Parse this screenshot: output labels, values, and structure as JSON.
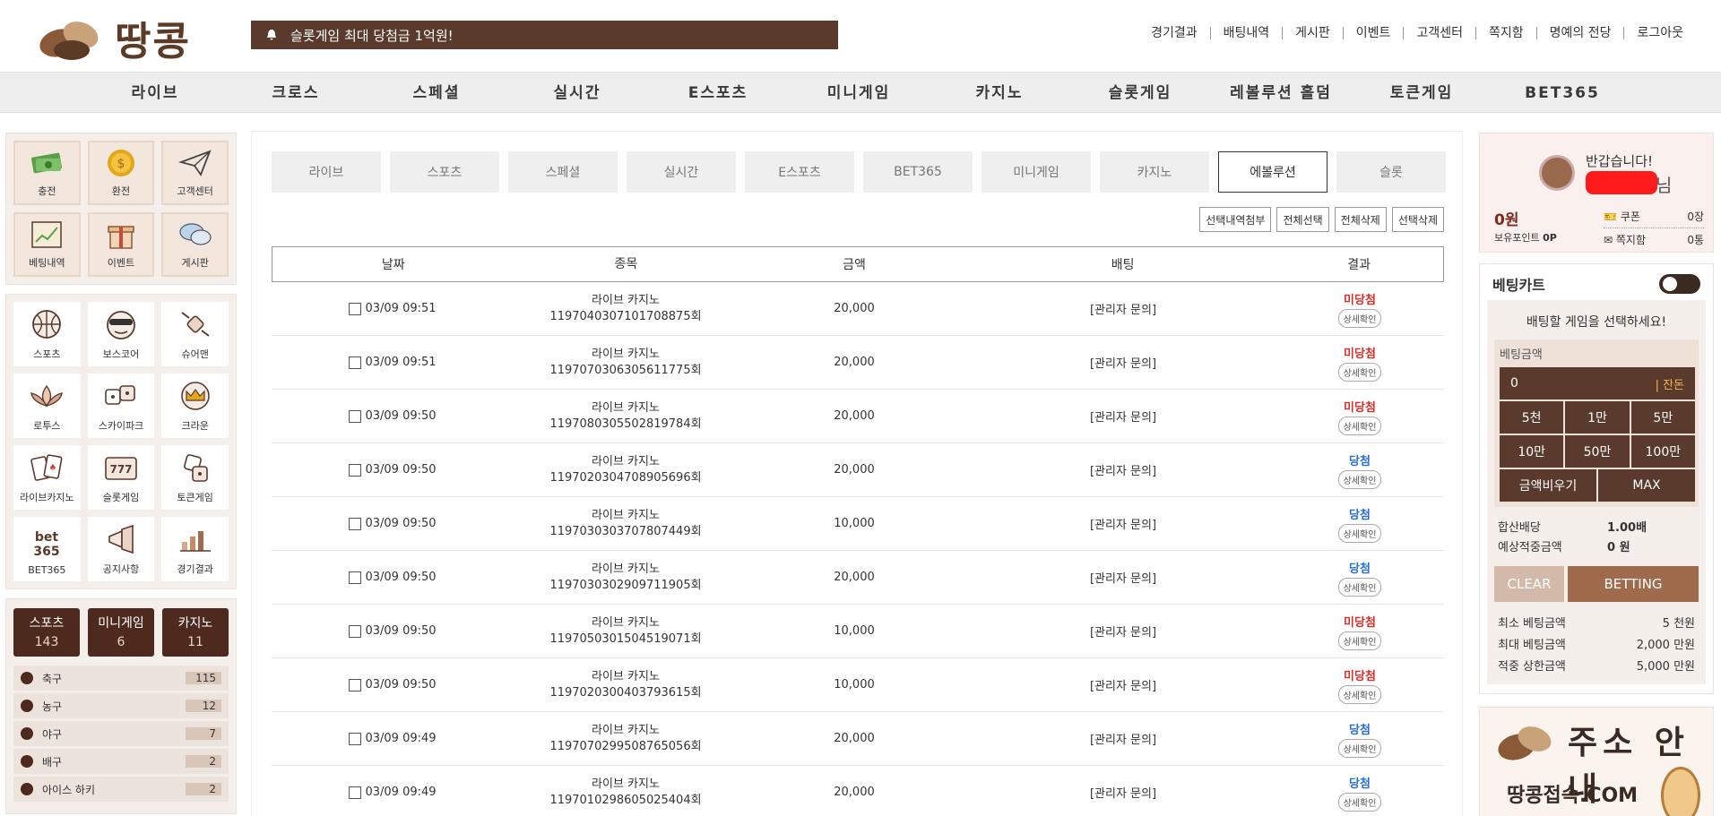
{
  "brand": {
    "logo_text": "땅콩"
  },
  "notice": {
    "text": "슬롯게임 최대 당첨금 1억원!"
  },
  "top_links": [
    "경기결과",
    "배팅내역",
    "게시판",
    "이벤트",
    "고객센터",
    "쪽지함",
    "명예의 전당",
    "로그아웃"
  ],
  "main_nav": [
    "라이브",
    "크로스",
    "스페셜",
    "실시간",
    "E스포츠",
    "미니게임",
    "카지노",
    "슬롯게임",
    "레볼루션 홀덤",
    "토큰게임",
    "BET365"
  ],
  "quick_menu": [
    "충전",
    "환전",
    "고객센터",
    "베팅내역",
    "이벤트",
    "게시판"
  ],
  "game_menu": [
    "스포츠",
    "보스코어",
    "슈어맨",
    "로투스",
    "스카이파크",
    "크라운",
    "라이브카지노",
    "슬롯게임",
    "토큰게임",
    "BET365",
    "공지사항",
    "경기결과"
  ],
  "sports_tabs": [
    {
      "label": "스포츠",
      "count": "143"
    },
    {
      "label": "미니게임",
      "count": "6"
    },
    {
      "label": "카지노",
      "count": "11"
    }
  ],
  "sports_list": [
    {
      "name": "축구",
      "count": "115"
    },
    {
      "name": "농구",
      "count": "12"
    },
    {
      "name": "야구",
      "count": "7"
    },
    {
      "name": "배구",
      "count": "2"
    },
    {
      "name": "아이스 하키",
      "count": "2"
    }
  ],
  "content_tabs": [
    "라이브",
    "스포츠",
    "스페셜",
    "실시간",
    "E스포츠",
    "BET365",
    "미니게임",
    "카지노",
    "에볼루션",
    "슬롯"
  ],
  "active_tab_index": 8,
  "action_buttons": [
    "선택내역첨부",
    "전체선택",
    "전체삭제",
    "선택삭제"
  ],
  "table_headers": [
    "날짜",
    "종목",
    "금액",
    "배팅",
    "결과"
  ],
  "rows": [
    {
      "date": "03/09 09:51",
      "game": "라이브 카지노",
      "round": "1197040307101708875회",
      "amount": "20,000",
      "bet": "[관리자 문의]",
      "result": "미당첨",
      "detail": "상세확인"
    },
    {
      "date": "03/09 09:51",
      "game": "라이브 카지노",
      "round": "1197070306305611775회",
      "amount": "20,000",
      "bet": "[관리자 문의]",
      "result": "미당첨",
      "detail": "상세확인"
    },
    {
      "date": "03/09 09:50",
      "game": "라이브 카지노",
      "round": "1197080305502819784회",
      "amount": "20,000",
      "bet": "[관리자 문의]",
      "result": "미당첨",
      "detail": "상세확인"
    },
    {
      "date": "03/09 09:50",
      "game": "라이브 카지노",
      "round": "1197020304708905696회",
      "amount": "20,000",
      "bet": "[관리자 문의]",
      "result": "당첨",
      "detail": "상세확인"
    },
    {
      "date": "03/09 09:50",
      "game": "라이브 카지노",
      "round": "1197030303707807449회",
      "amount": "10,000",
      "bet": "[관리자 문의]",
      "result": "당첨",
      "detail": "상세확인"
    },
    {
      "date": "03/09 09:50",
      "game": "라이브 카지노",
      "round": "1197030302909711905회",
      "amount": "20,000",
      "bet": "[관리자 문의]",
      "result": "당첨",
      "detail": "상세확인"
    },
    {
      "date": "03/09 09:50",
      "game": "라이브 카지노",
      "round": "1197050301504519071회",
      "amount": "10,000",
      "bet": "[관리자 문의]",
      "result": "미당첨",
      "detail": "상세확인"
    },
    {
      "date": "03/09 09:50",
      "game": "라이브 카지노",
      "round": "1197020300403793615회",
      "amount": "10,000",
      "bet": "[관리자 문의]",
      "result": "미당첨",
      "detail": "상세확인"
    },
    {
      "date": "03/09 09:49",
      "game": "라이브 카지노",
      "round": "1197070299508765056회",
      "amount": "20,000",
      "bet": "[관리자 문의]",
      "result": "당첨",
      "detail": "상세확인"
    },
    {
      "date": "03/09 09:49",
      "game": "라이브 카지노",
      "round": "1197010298605025404회",
      "amount": "20,000",
      "bet": "[관리자 문의]",
      "result": "당첨",
      "detail": "상세확인"
    }
  ],
  "profile": {
    "greeting": "반갑습니다!",
    "name_suffix": "님",
    "money": "0원",
    "points_label": "보유포인트",
    "points_value": "0P",
    "coupon_label": "쿠폰",
    "coupon_value": "0장",
    "msg_label": "쪽지함",
    "msg_value": "0통"
  },
  "cart": {
    "title": "베팅카트",
    "prompt": "배팅할 게임을 선택하세요!",
    "amount_label": "베팅금액",
    "amount_value": "0",
    "reset_label": "잔돈",
    "chips": [
      "5천",
      "1만",
      "5만",
      "10만",
      "50만",
      "100만"
    ],
    "clear_amount": "금액비우기",
    "max": "MAX",
    "odds_label": "합산배당",
    "odds_value": "1.00배",
    "expected_label": "예상적중금액",
    "expected_value": "0 원",
    "btn_clear": "CLEAR",
    "btn_bet": "BETTING",
    "limits": [
      {
        "label": "최소 베팅금액",
        "value": "5 천원"
      },
      {
        "label": "최대 베팅금액",
        "value": "2,000 만원"
      },
      {
        "label": "적중 상한금액",
        "value": "5,000 만원"
      }
    ]
  },
  "banner": {
    "title": "주소 안내",
    "sub": "땅콩접속.COM"
  },
  "colors": {
    "brand_dark": "#5b3a2e",
    "lose": "#d9302a",
    "win": "#2a6fd9"
  }
}
